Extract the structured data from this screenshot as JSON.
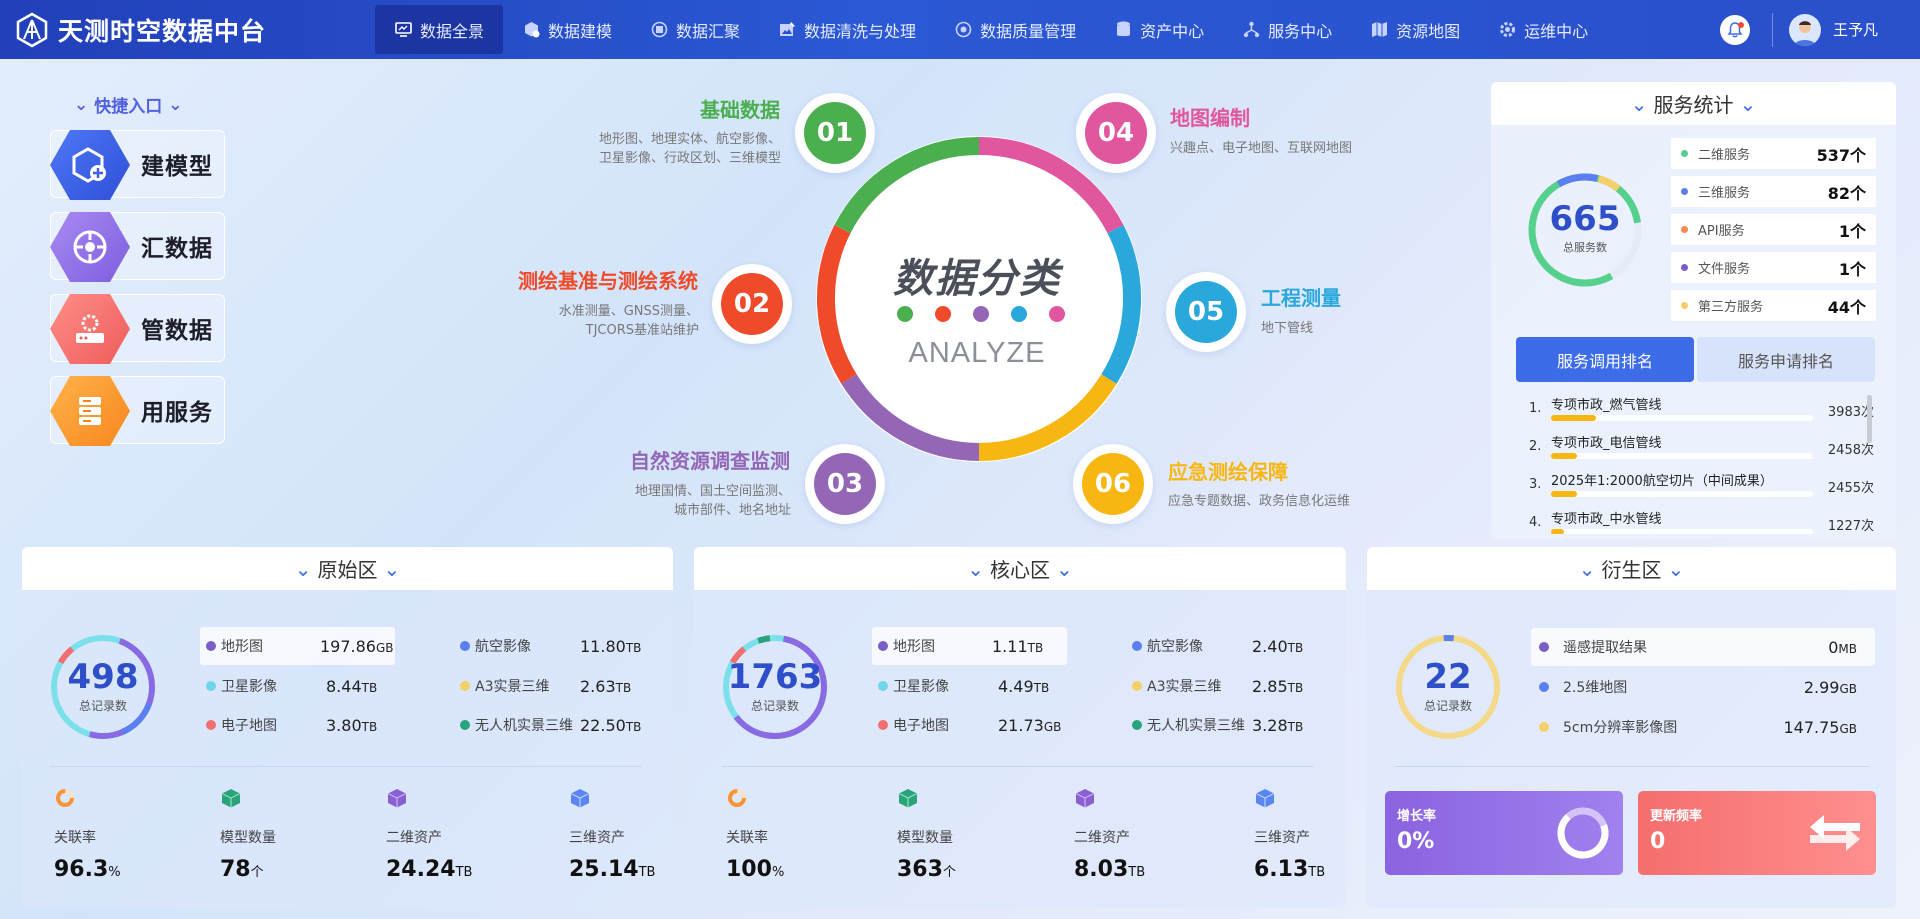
{
  "header": {
    "app_title": "天测时空数据中台",
    "user_name": "王予凡",
    "nav": [
      {
        "label": "数据全景",
        "icon": "monitor-icon",
        "active": true
      },
      {
        "label": "数据建模",
        "icon": "cube-icon"
      },
      {
        "label": "数据汇聚",
        "icon": "gather-icon"
      },
      {
        "label": "数据清洗与处理",
        "icon": "image-edit-icon"
      },
      {
        "label": "数据质量管理",
        "icon": "quality-icon"
      },
      {
        "label": "资产中心",
        "icon": "database-icon"
      },
      {
        "label": "服务中心",
        "icon": "network-icon"
      },
      {
        "label": "资源地图",
        "icon": "map-icon"
      },
      {
        "label": "运维中心",
        "icon": "gear-icon"
      }
    ]
  },
  "quick": {
    "title": "快捷入口",
    "items": [
      {
        "label": "建模型",
        "icon": "cube-plus-icon",
        "color": "#3e63e6"
      },
      {
        "label": "汇数据",
        "icon": "target-icon",
        "color": "#8c6ae8"
      },
      {
        "label": "管数据",
        "icon": "server-gear-icon",
        "color": "#f36f6f"
      },
      {
        "label": "用服务",
        "icon": "database-stack-icon",
        "color": "#f9962a"
      }
    ]
  },
  "center": {
    "title": "数据分类",
    "subtitle": "ANALYZE",
    "dot_colors": [
      "#4bae4f",
      "#ef4b2a",
      "#9367b6",
      "#2aa8dc",
      "#e0579f"
    ]
  },
  "categories": [
    {
      "num": "01",
      "title": "基础数据",
      "color": "#4bae4f",
      "desc": [
        "地形图、地理实体、航空影像、",
        "卫星影像、行政区划、三维模型"
      ]
    },
    {
      "num": "02",
      "title": "测绘基准与测绘系统",
      "color": "#ef4b2a",
      "desc": [
        "水准测量、GNSS测量、",
        "TJCORS基准站维护"
      ]
    },
    {
      "num": "03",
      "title": "自然资源调查监测",
      "color": "#9367b6",
      "desc": [
        "地理国情、国土空间监测、",
        "城市部件、地名地址"
      ]
    },
    {
      "num": "04",
      "title": "地图编制",
      "color": "#e0579f",
      "desc": [
        "兴趣点、电子地图、互联网地图"
      ]
    },
    {
      "num": "05",
      "title": "工程测量",
      "color": "#2aa8dc",
      "desc": [
        "地下管线"
      ]
    },
    {
      "num": "06",
      "title": "应急测绘保障",
      "color": "#f8b613",
      "desc": [
        "应急专题数据、政务信息化运维"
      ]
    }
  ],
  "service": {
    "title": "服务统计",
    "total": "665",
    "total_label": "总服务数",
    "items": [
      {
        "label": "二维服务",
        "value": "537个",
        "color": "#56d08d"
      },
      {
        "label": "三维服务",
        "value": "82个",
        "color": "#5b7ff0"
      },
      {
        "label": "API服务",
        "value": "1个",
        "color": "#f58a55"
      },
      {
        "label": "文件服务",
        "value": "1个",
        "color": "#7a5ec8"
      },
      {
        "label": "第三方服务",
        "value": "44个",
        "color": "#f5cf6a"
      }
    ],
    "tabs": [
      "服务调用排名",
      "服务申请排名"
    ],
    "ranking": [
      {
        "n": "1.",
        "name": "专项市政_燃气管线",
        "count": "3983次",
        "ratio": 0.17
      },
      {
        "n": "2.",
        "name": "专项市政_电信管线",
        "count": "2458次",
        "ratio": 0.1
      },
      {
        "n": "3.",
        "name": "2025年1:2000航空切片（中间成果）",
        "count": "2455次",
        "ratio": 0.1
      },
      {
        "n": "4.",
        "name": "专项市政_中水管线",
        "count": "1227次",
        "ratio": 0.05
      }
    ]
  },
  "zones": [
    {
      "title": "原始区",
      "total": "498",
      "total_label": "总记录数",
      "items": [
        {
          "name": "地形图",
          "value": "197.86",
          "unit": "GB",
          "color": "#7a5ec8"
        },
        {
          "name": "航空影像",
          "value": "11.80",
          "unit": "TB",
          "color": "#5b7ff0"
        },
        {
          "name": "卫星影像",
          "value": "8.44",
          "unit": "TB",
          "color": "#6fd6e8"
        },
        {
          "name": "A3实景三维",
          "value": "2.63",
          "unit": "TB",
          "color": "#f5cf6a"
        },
        {
          "name": "电子地图",
          "value": "3.80",
          "unit": "TB",
          "color": "#f36f6f"
        },
        {
          "name": "无人机实景三维",
          "value": "22.50",
          "unit": "TB",
          "color": "#2ba37a"
        }
      ],
      "kpis": [
        {
          "label": "关联率",
          "value": "96.3",
          "unit": "%"
        },
        {
          "label": "模型数量",
          "value": "78",
          "unit": "个"
        },
        {
          "label": "二维资产",
          "value": "24.24",
          "unit": "TB"
        },
        {
          "label": "三维资产",
          "value": "25.14",
          "unit": "TB"
        }
      ]
    },
    {
      "title": "核心区",
      "total": "1763",
      "total_label": "总记录数",
      "items": [
        {
          "name": "地形图",
          "value": "1.11",
          "unit": "TB",
          "color": "#7a5ec8"
        },
        {
          "name": "航空影像",
          "value": "2.40",
          "unit": "TB",
          "color": "#5b7ff0"
        },
        {
          "name": "卫星影像",
          "value": "4.49",
          "unit": "TB",
          "color": "#6fd6e8"
        },
        {
          "name": "A3实景三维",
          "value": "2.85",
          "unit": "TB",
          "color": "#f5cf6a"
        },
        {
          "name": "电子地图",
          "value": "21.73",
          "unit": "GB",
          "color": "#f36f6f"
        },
        {
          "name": "无人机实景三维",
          "value": "3.28",
          "unit": "TB",
          "color": "#2ba37a"
        }
      ],
      "kpis": [
        {
          "label": "关联率",
          "value": "100",
          "unit": "%"
        },
        {
          "label": "模型数量",
          "value": "363",
          "unit": "个"
        },
        {
          "label": "二维资产",
          "value": "8.03",
          "unit": "TB"
        },
        {
          "label": "三维资产",
          "value": "6.13",
          "unit": "TB"
        }
      ]
    },
    {
      "title": "衍生区",
      "total": "22",
      "total_label": "总记录数",
      "items": [
        {
          "name": "遥感提取结果",
          "value": "0",
          "unit": "MB",
          "color": "#7a5ec8"
        },
        {
          "name": "2.5维地图",
          "value": "2.99",
          "unit": "GB",
          "color": "#5b7ff0"
        },
        {
          "name": "5cm分辨率影像图",
          "value": "147.75",
          "unit": "GB",
          "color": "#f5cf6a"
        }
      ],
      "cards": [
        {
          "label": "增长率",
          "value": "0%"
        },
        {
          "label": "更新频率",
          "value": "0"
        }
      ]
    }
  ]
}
